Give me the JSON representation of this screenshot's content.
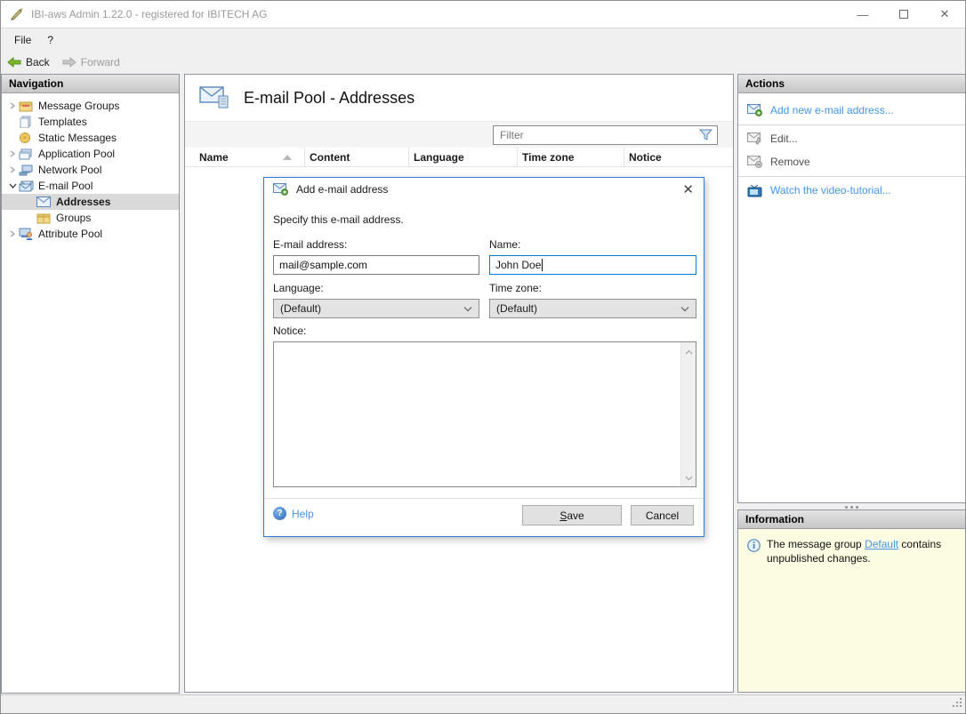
{
  "window": {
    "title": "IBI-aws Admin 1.22.0 - registered for IBITECH AG",
    "controls": {
      "minimize": "—",
      "close": "✕"
    }
  },
  "menu": {
    "file": "File",
    "help": "?"
  },
  "toolbar": {
    "back": "Back",
    "forward": "Forward"
  },
  "navigation": {
    "header": "Navigation",
    "items": [
      {
        "label": "Message Groups",
        "icon": "package-icon",
        "state": "collapsed"
      },
      {
        "label": "Templates",
        "icon": "pages-icon",
        "state": "leaf"
      },
      {
        "label": "Static Messages",
        "icon": "static-message-icon",
        "state": "leaf"
      },
      {
        "label": "Application Pool",
        "icon": "app-window-icon",
        "state": "collapsed"
      },
      {
        "label": "Network Pool",
        "icon": "network-icon",
        "state": "collapsed"
      },
      {
        "label": "E-mail Pool",
        "icon": "email-pool-icon",
        "state": "expanded"
      },
      {
        "label": "Addresses",
        "icon": "envelope-icon",
        "state": "leaf-selected"
      },
      {
        "label": "Groups",
        "icon": "package-icon",
        "state": "leaf"
      },
      {
        "label": "Attribute Pool",
        "icon": "attribute-icon",
        "state": "collapsed"
      }
    ]
  },
  "main": {
    "title": "E-mail Pool - Addresses",
    "filter_placeholder": "Filter",
    "columns": [
      "Name",
      "Content",
      "Language",
      "Time zone",
      "Notice"
    ],
    "rows": []
  },
  "dialog": {
    "title": "Add e-mail address",
    "subtitle": "Specify this e-mail address.",
    "fields": {
      "email": {
        "label": "E-mail address:",
        "value": "mail@sample.com"
      },
      "name": {
        "label": "Name:",
        "value": "John Doe"
      },
      "language": {
        "label": "Language:",
        "value": "(Default)"
      },
      "timezone": {
        "label": "Time zone:",
        "value": "(Default)"
      },
      "notice": {
        "label": "Notice:",
        "value": ""
      }
    },
    "help_label": "Help",
    "save_label": "Save",
    "cancel_label": "Cancel",
    "close_glyph": "✕"
  },
  "actions": {
    "header": "Actions",
    "items": [
      {
        "label": "Add new e-mail address...",
        "enabled": true
      },
      {
        "label": "Edit...",
        "enabled": false
      },
      {
        "label": "Remove",
        "enabled": false
      },
      {
        "label": "Watch the video-tutorial...",
        "enabled": true
      }
    ]
  },
  "information": {
    "header": "Information",
    "text_before": "The message group ",
    "link": "Default",
    "text_after": " contains unpublished changes."
  },
  "colors": {
    "accent_link": "#4495E8",
    "dialog_border": "#2B7CD3",
    "focus_border": "#0078D7",
    "info_bg": "#FCFCE2",
    "selection_bg": "#D9D9D9",
    "chrome_bg": "#F0F0F0"
  }
}
